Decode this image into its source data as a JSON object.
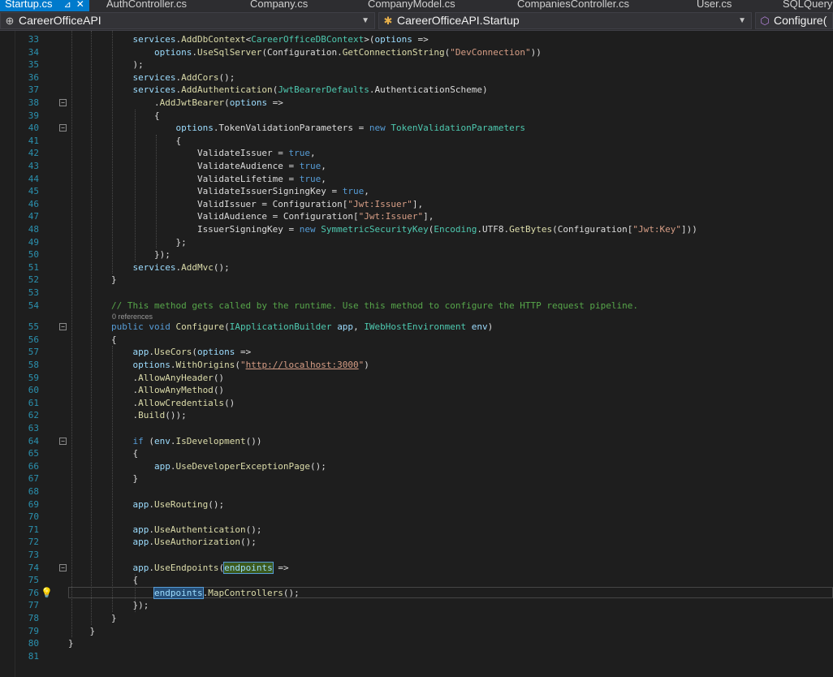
{
  "tabs": [
    {
      "label": "Startup.cs",
      "active": true
    },
    {
      "label": "AuthController.cs"
    },
    {
      "label": "Company.cs"
    },
    {
      "label": "CompanyModel.cs"
    },
    {
      "label": "CompaniesController.cs"
    },
    {
      "label": "User.cs"
    },
    {
      "label": "SQLQuery"
    }
  ],
  "nav": {
    "project": "CareerOfficeAPI",
    "class": "CareerOfficeAPI.Startup",
    "member": "Configure("
  },
  "codelens": "0 references",
  "lines": [
    {
      "n": "33",
      "code": "            <span class=\"p\">services</span>.<span class=\"f\">AddDbContext</span>&lt;<span class=\"t\">CareerOfficeDBContext</span>&gt;(<span class=\"p\">options</span> =&gt;"
    },
    {
      "n": "34",
      "code": "                <span class=\"p\">options</span>.<span class=\"f\">UseSqlServer</span>(Configuration.<span class=\"f\">GetConnectionString</span>(<span class=\"s\">\"DevConnection\"</span>))"
    },
    {
      "n": "35",
      "code": "            );"
    },
    {
      "n": "36",
      "code": "            <span class=\"p\">services</span>.<span class=\"f\">AddCors</span>();"
    },
    {
      "n": "37",
      "code": "            <span class=\"p\">services</span>.<span class=\"f\">AddAuthentication</span>(<span class=\"t\">JwtBearerDefaults</span>.AuthenticationScheme)"
    },
    {
      "n": "38",
      "code": "                .<span class=\"f\">AddJwtBearer</span>(<span class=\"p\">options</span> =&gt;",
      "fold": true
    },
    {
      "n": "39",
      "code": "                {"
    },
    {
      "n": "40",
      "code": "                    <span class=\"p\">options</span>.TokenValidationParameters = <span class=\"k\">new</span> <span class=\"t\">TokenValidationParameters</span>",
      "fold": true
    },
    {
      "n": "41",
      "code": "                    {"
    },
    {
      "n": "42",
      "code": "                        ValidateIssuer = <span class=\"k\">true</span>,"
    },
    {
      "n": "43",
      "code": "                        ValidateAudience = <span class=\"k\">true</span>,"
    },
    {
      "n": "44",
      "code": "                        ValidateLifetime = <span class=\"k\">true</span>,"
    },
    {
      "n": "45",
      "code": "                        ValidateIssuerSigningKey = <span class=\"k\">true</span>,"
    },
    {
      "n": "46",
      "code": "                        ValidIssuer = Configuration[<span class=\"s\">\"Jwt:Issuer\"</span>],"
    },
    {
      "n": "47",
      "code": "                        ValidAudience = Configuration[<span class=\"s\">\"Jwt:Issuer\"</span>],"
    },
    {
      "n": "48",
      "code": "                        IssuerSigningKey = <span class=\"k\">new</span> <span class=\"t\">SymmetricSecurityKey</span>(<span class=\"t\">Encoding</span>.UTF8.<span class=\"f\">GetBytes</span>(Configuration[<span class=\"s\">\"Jwt:Key\"</span>]))"
    },
    {
      "n": "49",
      "code": "                    };"
    },
    {
      "n": "50",
      "code": "                });"
    },
    {
      "n": "51",
      "code": "            <span class=\"p\">services</span>.<span class=\"f\">AddMvc</span>();"
    },
    {
      "n": "52",
      "code": "        }"
    },
    {
      "n": "53",
      "code": ""
    },
    {
      "n": "54",
      "code": "        <span class=\"c\">// This method gets called by the runtime. Use this method to configure the HTTP request pipeline.</span>"
    },
    {
      "n": "55",
      "code": "        <span class=\"k\">public</span> <span class=\"k\">void</span> <span class=\"f\">Configure</span>(<span class=\"t\">IApplicationBuilder</span> <span class=\"p\">app</span>, <span class=\"t\">IWebHostEnvironment</span> <span class=\"p\">env</span>)",
      "fold": true,
      "lens": true
    },
    {
      "n": "56",
      "code": "        {"
    },
    {
      "n": "57",
      "code": "            <span class=\"p\">app</span>.<span class=\"f\">UseCors</span>(<span class=\"p\">options</span> =&gt;"
    },
    {
      "n": "58",
      "code": "            <span class=\"p\">options</span>.<span class=\"f\">WithOrigins</span>(<span class=\"s\">\"</span><span class=\"u\">http://localhost:3000</span><span class=\"s\">\"</span>)"
    },
    {
      "n": "59",
      "code": "            .<span class=\"f\">AllowAnyHeader</span>()"
    },
    {
      "n": "60",
      "code": "            .<span class=\"f\">AllowAnyMethod</span>()"
    },
    {
      "n": "61",
      "code": "            .<span class=\"f\">AllowCredentials</span>()"
    },
    {
      "n": "62",
      "code": "            .<span class=\"f\">Build</span>());"
    },
    {
      "n": "63",
      "code": ""
    },
    {
      "n": "64",
      "code": "            <span class=\"k\">if</span> (<span class=\"p\">env</span>.<span class=\"f\">IsDevelopment</span>())",
      "fold": true
    },
    {
      "n": "65",
      "code": "            {"
    },
    {
      "n": "66",
      "code": "                <span class=\"p\">app</span>.<span class=\"f\">UseDeveloperExceptionPage</span>();"
    },
    {
      "n": "67",
      "code": "            }"
    },
    {
      "n": "68",
      "code": ""
    },
    {
      "n": "69",
      "code": "            <span class=\"p\">app</span>.<span class=\"f\">UseRouting</span>();"
    },
    {
      "n": "70",
      "code": ""
    },
    {
      "n": "71",
      "code": "            <span class=\"p\">app</span>.<span class=\"f\">UseAuthentication</span>();"
    },
    {
      "n": "72",
      "code": "            <span class=\"p\">app</span>.<span class=\"f\">UseAuthorization</span>();"
    },
    {
      "n": "73",
      "code": ""
    },
    {
      "n": "74",
      "code": "            <span class=\"p\">app</span>.<span class=\"f\">UseEndpoints</span>(<span class=\"p hl-a\">endpoints</span> =&gt;",
      "fold": true
    },
    {
      "n": "75",
      "code": "            {"
    },
    {
      "n": "76",
      "code": "                <span class=\"p hl-b\">endpoints</span>.<span class=\"f\">MapControllers</span>();",
      "current": true,
      "bulb": true
    },
    {
      "n": "77",
      "code": "            });"
    },
    {
      "n": "78",
      "code": "        }"
    },
    {
      "n": "79",
      "code": "    }"
    },
    {
      "n": "80",
      "code": "}"
    },
    {
      "n": "81",
      "code": ""
    }
  ]
}
